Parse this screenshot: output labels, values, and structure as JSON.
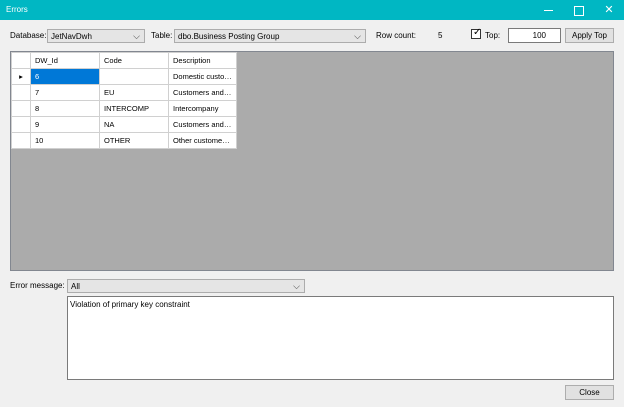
{
  "window": {
    "title": "Errors"
  },
  "toolbar": {
    "database_label": "Database:",
    "database_value": "JetNavDwh",
    "table_label": "Table:",
    "table_value": "dbo.Business Posting Group",
    "rowcount_label": "Row count:",
    "rowcount_value": "5",
    "top_label": "Top:",
    "top_checked": true,
    "top_value": "100",
    "apply_top_label": "Apply Top"
  },
  "grid": {
    "columns": [
      "DW_Id",
      "Code",
      "Description"
    ],
    "rows": [
      [
        "6",
        "",
        "Domestic custom..."
      ],
      [
        "7",
        "EU",
        "Customers and v..."
      ],
      [
        "8",
        "INTERCOMP",
        "Intercompany"
      ],
      [
        "9",
        "NA",
        "Customers and V..."
      ],
      [
        "10",
        "OTHER",
        "Other customers ..."
      ]
    ],
    "current_row_marker": "▸"
  },
  "error_filter": {
    "label": "Error message:",
    "value": "All"
  },
  "message": {
    "text": "Violation of primary key constraint"
  },
  "footer": {
    "close_label": "Close"
  },
  "colors": {
    "titlebar": "#00b7c3",
    "selection": "#0078d7"
  }
}
